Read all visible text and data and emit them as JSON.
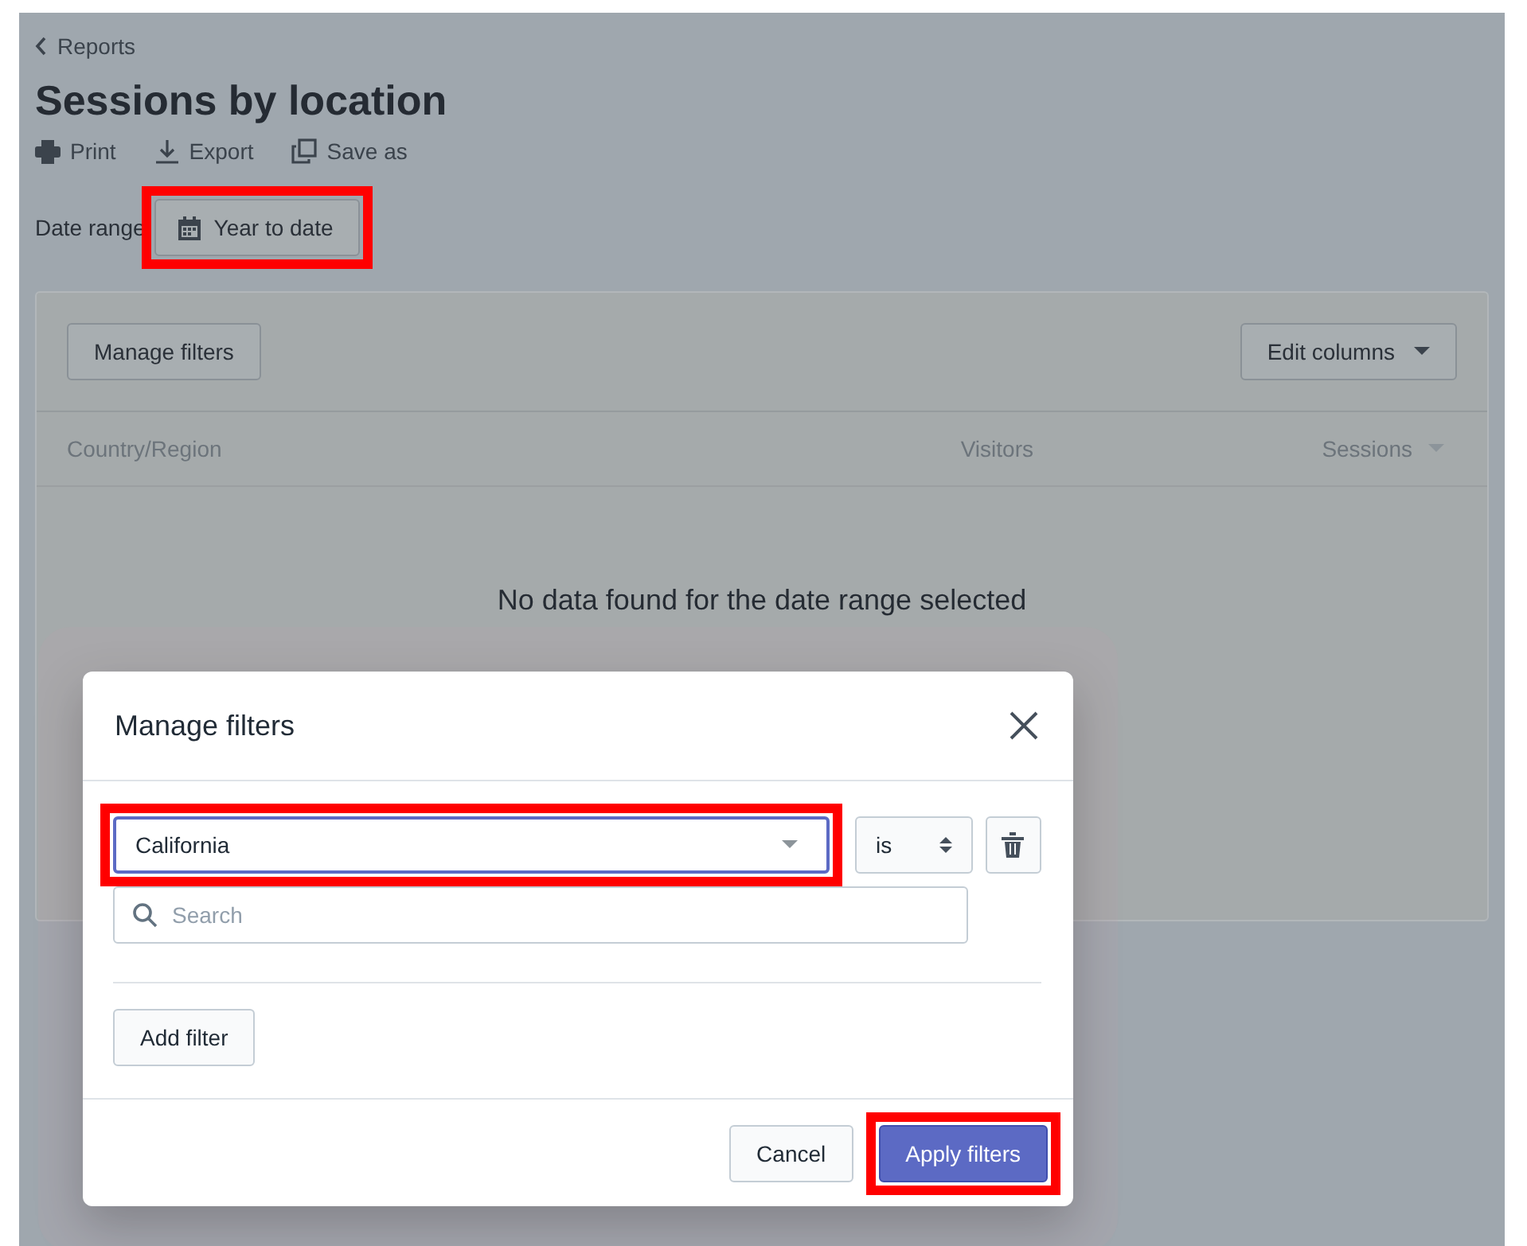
{
  "back_link": {
    "label": "Reports"
  },
  "title": "Sessions by location",
  "actions": [
    {
      "label": "Print"
    },
    {
      "label": "Export"
    },
    {
      "label": "Save as"
    }
  ],
  "date_range": {
    "label": "Date range",
    "button": "Year to date",
    "highlighted": true
  },
  "card": {
    "manage_filters": "Manage filters",
    "edit_columns": "Edit columns",
    "columns": [
      {
        "label": "Country/Region",
        "sorted": false
      },
      {
        "label": "Visitors",
        "sorted": false
      },
      {
        "label": "Sessions",
        "sorted": true
      }
    ],
    "empty_message": "No data found for the date range selected"
  },
  "modal": {
    "title": "Manage filters",
    "filters": [
      {
        "value": "California",
        "value_highlighted": true,
        "operator": "is",
        "search_placeholder": "Search"
      }
    ],
    "add_filter": "Add filter",
    "buttons": [
      {
        "label": "Cancel",
        "kind": "secondary",
        "highlighted": false
      },
      {
        "label": "Apply filters",
        "kind": "primary",
        "highlighted": true
      }
    ]
  }
}
